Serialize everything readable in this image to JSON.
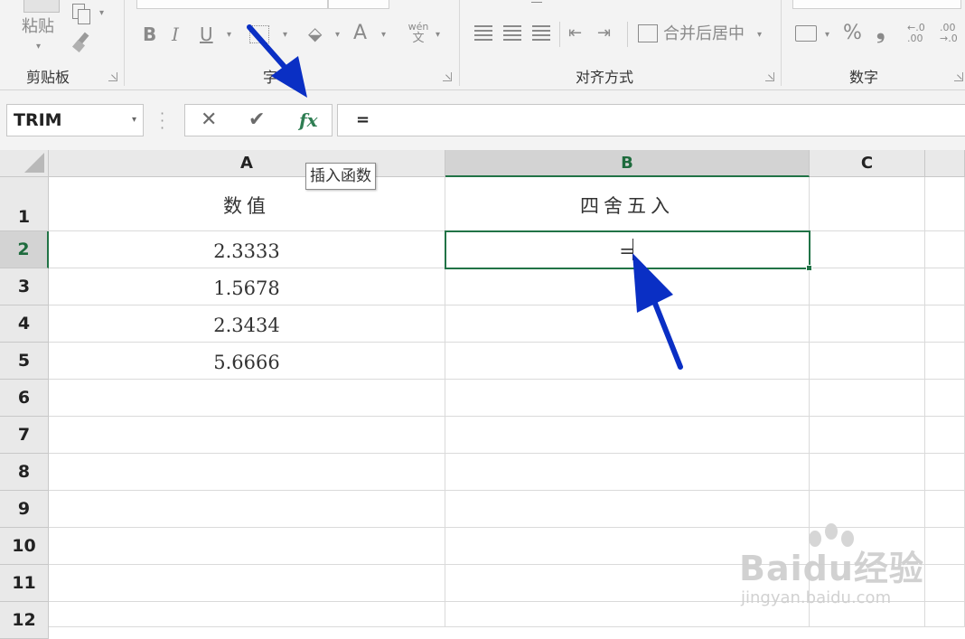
{
  "ribbon": {
    "clipboard": {
      "paste_label": "粘贴",
      "group_label": "剪贴板"
    },
    "font": {
      "bold": "B",
      "italic": "I",
      "underline": "U",
      "font_color": "A",
      "phonetic_top": "wén",
      "phonetic_bottom": "文",
      "group_label": "字"
    },
    "alignment": {
      "merge_center_label": "合并后居中",
      "group_label": "对齐方式"
    },
    "number": {
      "percent": "%",
      "comma": "❟",
      "increase_decimal_top": "←.0",
      "increase_decimal_bottom": ".00",
      "decrease_decimal_top": ".00",
      "decrease_decimal_bottom": "→.0",
      "group_label": "数字"
    }
  },
  "formula_bar": {
    "name_box": "TRIM",
    "cancel": "✕",
    "enter": "✔",
    "insert_function": "fx",
    "formula": "="
  },
  "tooltip": "插入函数",
  "sheet": {
    "columns": [
      "A",
      "B",
      "C"
    ],
    "rows": [
      "1",
      "2",
      "3",
      "4",
      "5",
      "6",
      "7",
      "8",
      "9",
      "10",
      "11",
      "12"
    ],
    "active_cell": "B2",
    "cells": {
      "A1": "数值",
      "B1": "四舍五入",
      "A2": "2.3333",
      "B2": "=",
      "A3": "1.5678",
      "A4": "2.3434",
      "A5": "5.6666"
    }
  },
  "watermark": {
    "main": "Baidu经验",
    "sub": "jingyan.baidu.com"
  },
  "colors": {
    "accent": "#217346",
    "annotation_arrow": "#0a2fc4",
    "fx_green": "#2e7d52"
  }
}
